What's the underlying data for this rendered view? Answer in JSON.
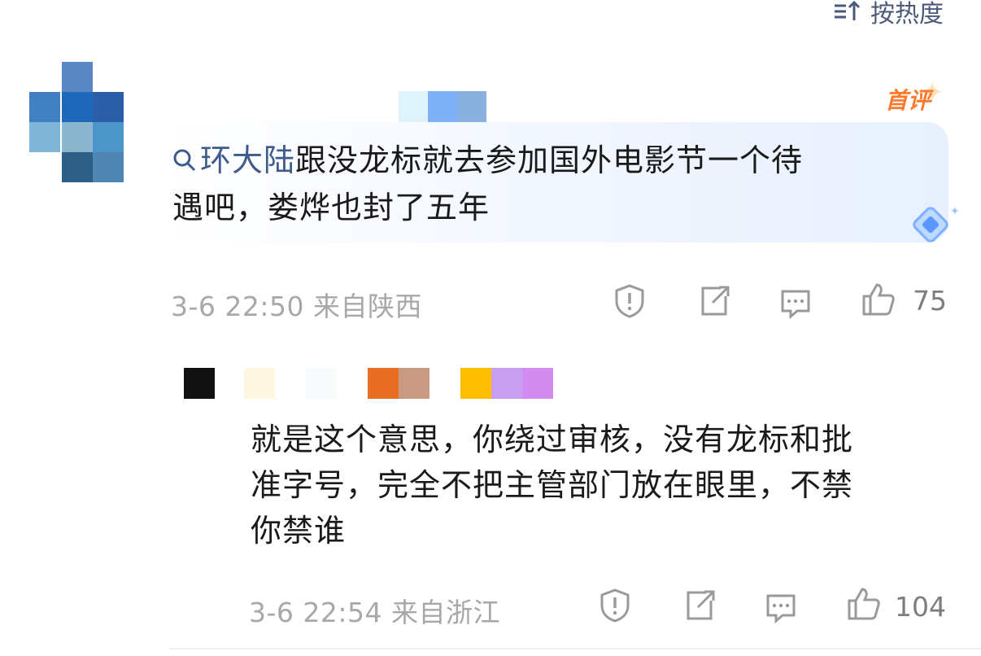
{
  "sort": {
    "label": "按热度",
    "icon": "sort-icon"
  },
  "comment": {
    "badge": "首评",
    "keyword": "环大陆",
    "text_line1": "跟没龙标就去参加国外电影节一个待",
    "text_line2": "遇吧，娄烨也封了五年",
    "time": "3-6 22:50",
    "location": "来自陕西",
    "like_count": "75",
    "actions": [
      "report-icon",
      "share-icon",
      "comment-icon",
      "like-icon"
    ]
  },
  "reply": {
    "text_line1": "就是这个意思，你绕过审核，没有龙标和批",
    "text_line2": "准字号，完全不把主管部门放在眼里，不禁",
    "text_line3": "你禁谁",
    "time": "3-6 22:54",
    "location": "来自浙江",
    "like_count": "104"
  },
  "colors": {
    "keyword": "#3f5b8c",
    "badge": "#ff7a2c",
    "meta": "#a8a8a8",
    "icon_stroke": "#9a9a9a"
  }
}
